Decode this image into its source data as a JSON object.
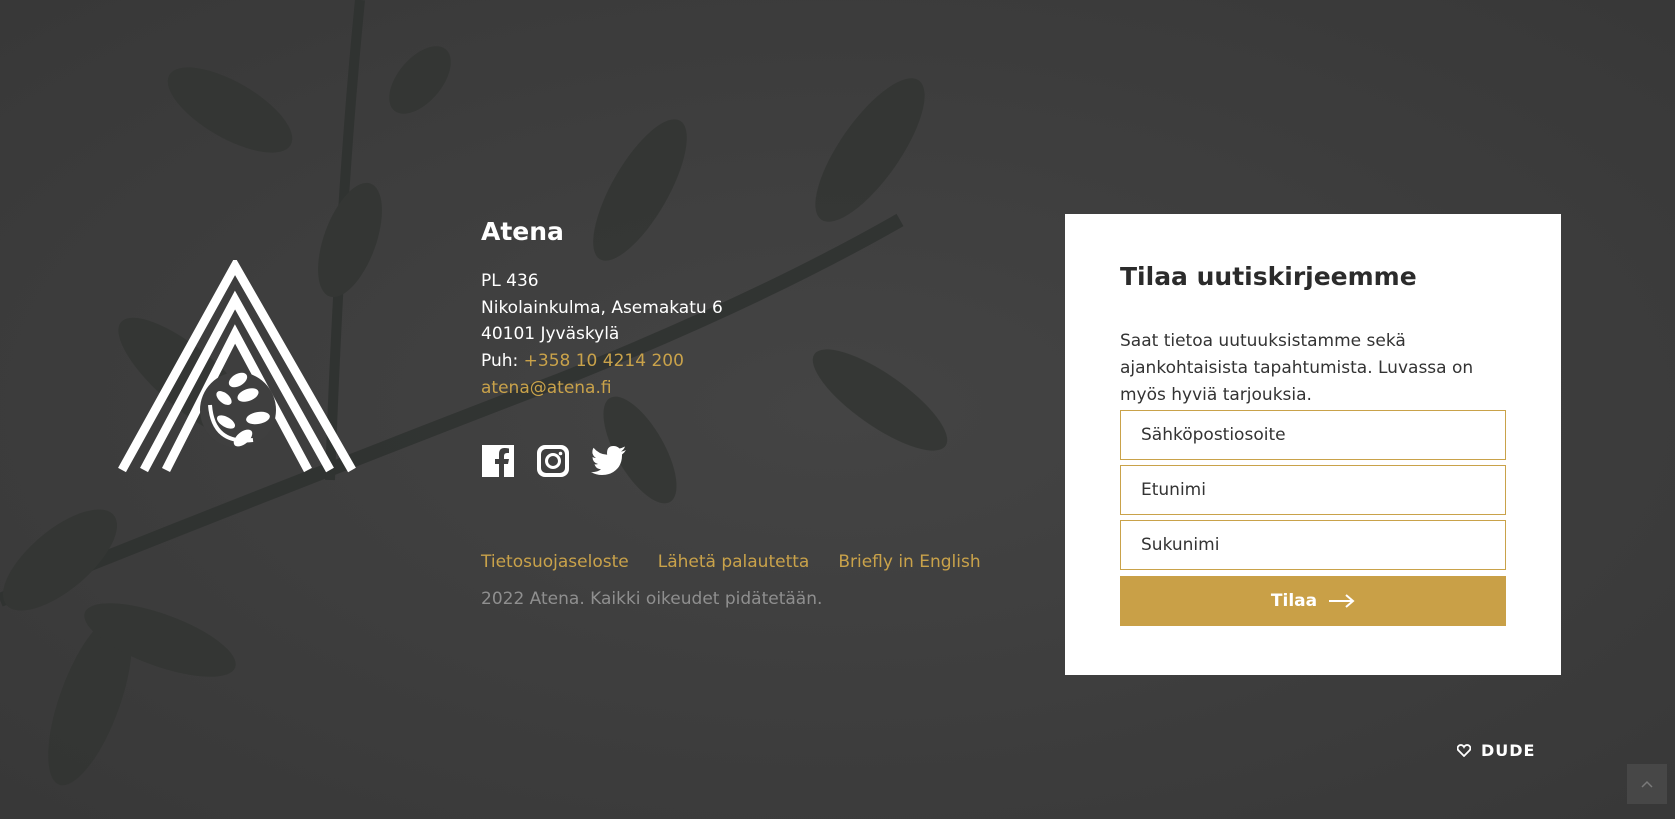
{
  "footer": {
    "brand": "Atena",
    "address_line1": "PL 436",
    "address_line2": "Nikolainkulma, Asemakatu 6",
    "address_line3": "40101 Jyväskylä",
    "phone_label": "Puh:",
    "phone": "+358 10 4214 200",
    "email": "atena@atena.fi",
    "social": [
      "facebook-icon",
      "instagram-icon",
      "twitter-icon"
    ],
    "links": [
      "Tietosuojaseloste",
      "Lähetä palautetta",
      "Briefly in English"
    ],
    "copyright": "2022 Atena. Kaikki oikeudet pidätetään."
  },
  "newsletter": {
    "title": "Tilaa uutiskirjeemme",
    "description": "Saat tietoa uutuuksistamme sekä ajankohtaisista tapahtumista. Luvassa on myös hyviä tarjouksia.",
    "email_placeholder": "Sähköpostiosoite",
    "firstname_placeholder": "Etunimi",
    "lastname_placeholder": "Sukunimi",
    "submit_label": "Tilaa"
  },
  "credit": {
    "label": "DUDE",
    "icon": "heart-icon"
  },
  "scroll_top": {
    "icon": "chevron-up-icon"
  },
  "colors": {
    "accent": "#c9a24a",
    "button": "#c9a047",
    "background": "#3f3f3f",
    "muted": "#8f8f8f"
  }
}
